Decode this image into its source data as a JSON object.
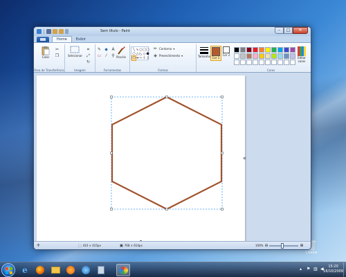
{
  "window": {
    "title": "Sem título - Paint"
  },
  "tabs": [
    {
      "label": "Home"
    },
    {
      "label": "Exibir"
    }
  ],
  "ribbon": {
    "clipboard": {
      "paste_label": "Colar",
      "group_label": "Área de Transferência"
    },
    "image": {
      "select_label": "Selecionar",
      "group_label": "Imagem"
    },
    "tools": {
      "group_label": "Ferramentas",
      "brushes_label": "Pincéis"
    },
    "shapes": {
      "group_label": "Formas",
      "outline_label": "Contorno",
      "fill_label": "Preenchimento"
    },
    "size": {
      "label": "Tamanho"
    },
    "color1": {
      "label": "Cor 1",
      "color": "#b45a2c"
    },
    "color2": {
      "label": "Cor 2",
      "color": "#ffffff"
    },
    "colors": {
      "group_label": "Cores",
      "edit_label": "Editar cores",
      "palette": [
        "#000000",
        "#7f7f7f",
        "#880015",
        "#ed1c24",
        "#ff7f27",
        "#fff200",
        "#22b14c",
        "#00a2e8",
        "#3f48cc",
        "#a349a4",
        "#ffffff",
        "#c3c3c3",
        "#b97a57",
        "#ffaec9",
        "#ffc90e",
        "#efe4b0",
        "#b5e61d",
        "#99d9ea",
        "#7092be",
        "#c8bfe7",
        "#ffffff",
        "#ffffff",
        "#ffffff",
        "#ffffff",
        "#ffffff",
        "#ffffff",
        "#ffffff",
        "#ffffff",
        "#ffffff",
        "#ffffff"
      ]
    }
  },
  "canvas": {
    "shape": "hexagon",
    "stroke_color": "#a0522d"
  },
  "status": {
    "selection_size": "410 × 415px",
    "canvas_size": "768 × 614px",
    "zoom": "100%"
  },
  "desktop": {
    "recycle_bin_label": "Lixeira"
  },
  "taskbar": {
    "time": "15:20",
    "date": "16/10/2009"
  }
}
